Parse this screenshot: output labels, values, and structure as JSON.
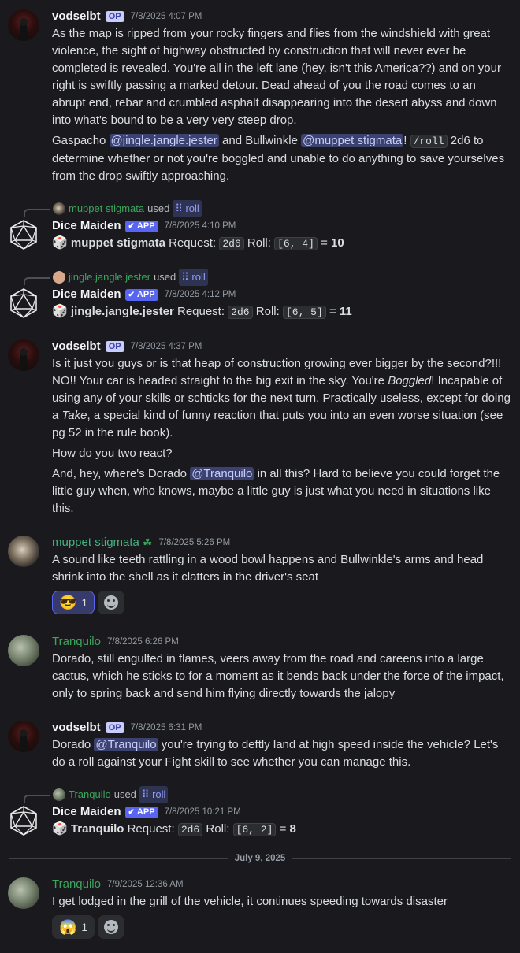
{
  "messages": [
    {
      "author": "vodselbt",
      "badge": "OP",
      "timestamp": "7/8/2025 4:07 PM",
      "paragraph1": "As the map is  ripped from your rocky fingers and flies from the windshield with great violence, the sight of highway obstructed by construction that will never ever be completed is revealed. You're all in the left lane (hey, isn't this America??) and on your right is swiftly passing a marked detour. Dead ahead of you the road comes to an abrupt end, rebar and crumbled asphalt disappearing into the desert abyss and down into what's bound to be a very very steep drop.",
      "p2_a": "Gaspacho ",
      "p2_mention1": "@jingle.jangle.jester",
      "p2_b": " and Bullwinkle ",
      "p2_mention2": "@muppet stigmata",
      "p2_c": "! ",
      "p2_code": "/roll",
      "p2_d": " 2d6 to determine whether or not you're boggled and unable to do anything to save yourselves from the drop swiftly approaching."
    },
    {
      "reply_name": "muppet stigmata",
      "reply_used": "used",
      "reply_cmd": "roll",
      "author": "Dice Maiden",
      "badge": "APP",
      "timestamp": "7/8/2025 4:10 PM",
      "roller": "muppet stigmata",
      "request_label": "Request:",
      "request": "2d6",
      "roll_label": "Roll:",
      "roll": "[6, 4]",
      "equals": "=",
      "total": "10"
    },
    {
      "reply_name": "jingle.jangle.jester",
      "reply_used": "used",
      "reply_cmd": "roll",
      "author": "Dice Maiden",
      "badge": "APP",
      "timestamp": "7/8/2025 4:12 PM",
      "roller": "jingle.jangle.jester",
      "request_label": "Request:",
      "request": "2d6",
      "roll_label": "Roll:",
      "roll": "[6, 5]",
      "equals": "=",
      "total": "11"
    },
    {
      "author": "vodselbt",
      "badge": "OP",
      "timestamp": "7/8/2025 4:37 PM",
      "p1_a": "Is it just you guys or is that heap of construction growing ever bigger by the second?!!! NO!! Your car is headed straight to the big exit in the sky. You're ",
      "p1_em1": "Boggled",
      "p1_b": "! Incapable of using any of your skills or schticks for the next turn. Practically useless, except for doing a ",
      "p1_em2": "Take",
      "p1_c": ", a special kind of funny reaction that puts you into an even worse situation (see pg 52 in the rule book).",
      "paragraph2": "How do you two react?",
      "p3_a": "And, hey, where's Dorado ",
      "p3_mention": "@Tranquilo",
      "p3_b": " in all this? Hard to believe you could forget the little guy when, who knows, maybe a little guy is just what you need in situations like this."
    },
    {
      "author": "muppet stigmata",
      "timestamp": "7/8/2025 5:26 PM",
      "text": "A sound like teeth rattling in a wood bowl happens and Bullwinkle's arms and head shrink into the shell as it clatters in the driver's seat",
      "reaction_count": "1"
    },
    {
      "author": "Tranquilo",
      "timestamp": "7/8/2025 6:26 PM",
      "text": "Dorado, still engulfed in flames, veers away from the road and careens into a large cactus, which he sticks to for a moment as it bends back under the force of the impact, only to spring back and send him flying directly towards the jalopy"
    },
    {
      "author": "vodselbt",
      "badge": "OP",
      "timestamp": "7/8/2025 6:31 PM",
      "t_a": "Dorado ",
      "t_mention": "@Tranquilo",
      "t_b": " you're trying to deftly land at high speed inside the vehicle? Let's do a roll against your Fight skill to see whether you can manage this."
    },
    {
      "reply_name": "Tranquilo",
      "reply_used": "used",
      "reply_cmd": "roll",
      "author": "Dice Maiden",
      "badge": "APP",
      "timestamp": "7/8/2025 10:21 PM",
      "roller": "Tranquilo",
      "request_label": "Request:",
      "request": "2d6",
      "roll_label": "Roll:",
      "roll": "[6, 2]",
      "equals": "=",
      "total": "8"
    },
    {
      "author": "Tranquilo",
      "timestamp": "7/9/2025 12:36 AM",
      "text": "I get lodged in the grill of the vehicle, it continues speeding towards disaster",
      "reaction_count": "1"
    }
  ],
  "date_divider": "July 9, 2025",
  "icons": {
    "die": "game-die-icon",
    "app_check": "checkmark-icon",
    "command": "slash-command-icon",
    "reaction_1": "sunglasses-emoji",
    "reaction_2": "scream-emoji",
    "add_reaction": "add-reaction-icon",
    "clover": "four-leaf-clover-icon"
  },
  "colors": {
    "background": "#1a1a1e",
    "accent": "#5865f2",
    "username_green": "#3ba55c",
    "mention_bg": "#3c4270"
  }
}
